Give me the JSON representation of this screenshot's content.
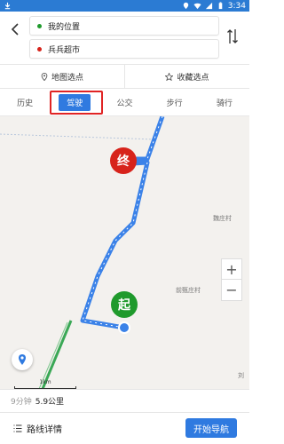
{
  "status_bar": {
    "time": "3:34"
  },
  "route": {
    "start_label": "我的位置",
    "end_label": "兵兵超市",
    "start_color": "#1f9a2c",
    "end_color": "#d7231b"
  },
  "picks": {
    "map_pick": "地图选点",
    "fav_pick": "收藏选点"
  },
  "tabs": [
    {
      "label": "历史",
      "active": false
    },
    {
      "label": "驾驶",
      "active": true
    },
    {
      "label": "公交",
      "active": false
    },
    {
      "label": "步行",
      "active": false
    },
    {
      "label": "骑行",
      "active": false
    }
  ],
  "map": {
    "end_marker": "终",
    "start_marker": "起",
    "places": [
      "魏庄村",
      "前甄庄村",
      "刘"
    ],
    "scale_label": "1km",
    "zoom_in": "+",
    "zoom_out": "−",
    "route_color": "#3b82e8"
  },
  "summary": {
    "time": "9分钟",
    "distance": "5.9公里"
  },
  "bottom": {
    "details_label": "路线详情",
    "start_nav_label": "开始导航"
  },
  "icons": {
    "back": "back-arrow-icon",
    "swap": "swap-icon",
    "pin": "pin-icon",
    "star": "star-icon",
    "locate": "locate-icon",
    "list": "list-icon"
  }
}
